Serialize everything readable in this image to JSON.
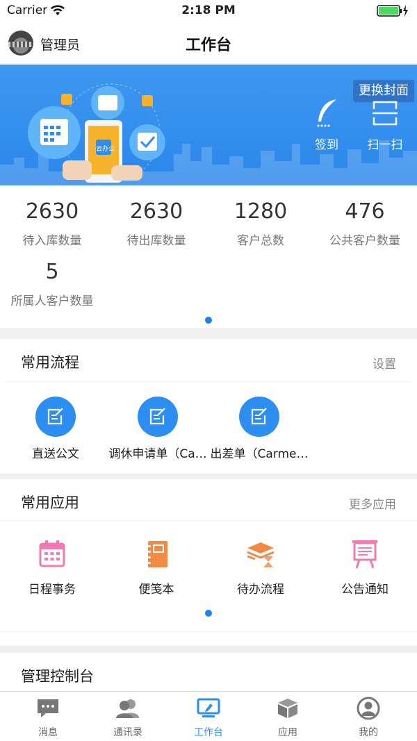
{
  "status_bar": {
    "carrier": "Carrier",
    "time": "2:18 PM"
  },
  "nav": {
    "user_name": "管理员",
    "title": "工作台"
  },
  "banner": {
    "cover_button": "更换封面",
    "actions": [
      {
        "label": "签到",
        "icon": "feather-icon"
      },
      {
        "label": "扫一扫",
        "icon": "scan-icon"
      }
    ],
    "illustration_app_text": "云办公"
  },
  "stats": [
    {
      "value": "2630",
      "label": "待入库数量"
    },
    {
      "value": "2630",
      "label": "待出库数量"
    },
    {
      "value": "1280",
      "label": "客户总数"
    },
    {
      "value": "476",
      "label": "公共客户数量"
    },
    {
      "value": "5",
      "label": "所属人客户数量"
    }
  ],
  "processes": {
    "title": "常用流程",
    "link": "设置",
    "items": [
      {
        "label": "直送公文",
        "icon": "edit-doc-icon"
      },
      {
        "label": "调休申请单（Ca…",
        "icon": "edit-doc-icon"
      },
      {
        "label": "出差单（Carme…",
        "icon": "edit-doc-icon"
      }
    ]
  },
  "apps": {
    "title": "常用应用",
    "link": "更多应用",
    "items": [
      {
        "label": "日程事务",
        "icon": "calendar-icon",
        "color": "#f07bb0"
      },
      {
        "label": "便笺本",
        "icon": "notebook-icon",
        "color": "#f08a45"
      },
      {
        "label": "待办流程",
        "icon": "hourglass-icon",
        "color": "#f08a45"
      },
      {
        "label": "公告通知",
        "icon": "easel-board-icon",
        "color": "#f07bb0"
      }
    ]
  },
  "console": {
    "title": "管理控制台"
  },
  "tabs": [
    {
      "label": "消息",
      "icon": "chat-bubble-icon",
      "active": false
    },
    {
      "label": "通讯录",
      "icon": "contacts-icon",
      "active": false
    },
    {
      "label": "工作台",
      "icon": "monitor-icon",
      "active": true
    },
    {
      "label": "应用",
      "icon": "cube-icon",
      "active": false
    },
    {
      "label": "我的",
      "icon": "user-circle-icon",
      "active": false
    }
  ],
  "colors": {
    "accent": "#2b8ef0",
    "banner": "#3f98f0"
  }
}
